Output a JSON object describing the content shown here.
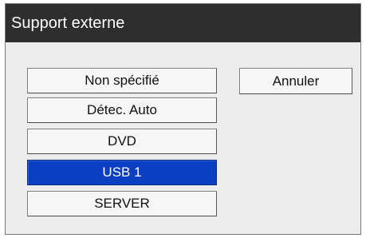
{
  "dialog": {
    "title": "Support externe"
  },
  "options": [
    {
      "label": "Non spécifié",
      "selected": false
    },
    {
      "label": "Détec. Auto",
      "selected": false
    },
    {
      "label": "DVD",
      "selected": false
    },
    {
      "label": "USB 1",
      "selected": true
    },
    {
      "label": "SERVER",
      "selected": false
    }
  ],
  "cancel": {
    "label": "Annuler"
  },
  "colors": {
    "title_bar": "#2e2e2e",
    "selection": "#0b3fc3",
    "dialog_bg": "#ececec"
  }
}
